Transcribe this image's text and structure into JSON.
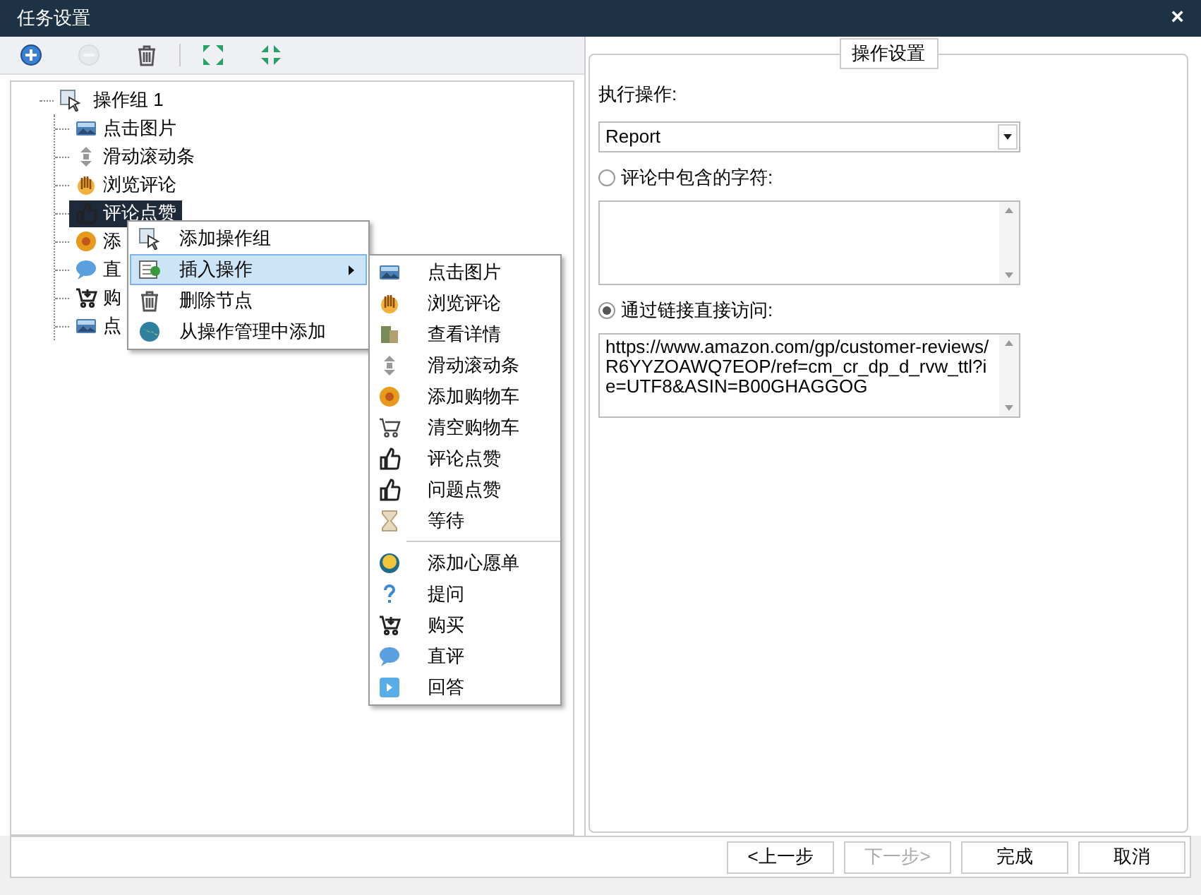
{
  "window": {
    "title": "任务设置",
    "close": "×"
  },
  "toolbar": [
    {
      "kind": "add",
      "disabled": false
    },
    {
      "kind": "remove",
      "disabled": true
    },
    {
      "kind": "trash",
      "disabled": false
    },
    {
      "kind": "expand",
      "disabled": false
    },
    {
      "kind": "collapse",
      "disabled": false
    }
  ],
  "tree": {
    "label": "操作组 1",
    "kind": "cursor",
    "children": [
      {
        "label": "点击图片",
        "kind": "image",
        "selected": false
      },
      {
        "label": "滑动滚动条",
        "kind": "scroll",
        "selected": false
      },
      {
        "label": "浏览评论",
        "kind": "hand",
        "selected": false
      },
      {
        "label": "评论点赞",
        "kind": "thumb",
        "selected": true
      },
      {
        "label": "添",
        "kind": "basket",
        "selected": false
      },
      {
        "label": "直",
        "kind": "chat",
        "selected": false
      },
      {
        "label": "购",
        "kind": "cart",
        "selected": false
      },
      {
        "label": "点",
        "kind": "image",
        "selected": false
      }
    ]
  },
  "context_menu": {
    "items": [
      {
        "label": "添加操作组",
        "kind": "cursor",
        "selected": false,
        "submenu": false
      },
      {
        "label": "插入操作",
        "kind": "insert",
        "selected": true,
        "submenu": true
      },
      {
        "label": "删除节点",
        "kind": "trash",
        "selected": false,
        "submenu": false
      },
      {
        "label": "从操作管理中添加",
        "kind": "globe",
        "selected": false,
        "submenu": false
      }
    ]
  },
  "submenu": {
    "groups": [
      [
        {
          "label": "点击图片",
          "kind": "image"
        },
        {
          "label": "浏览评论",
          "kind": "hand"
        },
        {
          "label": "查看详情",
          "kind": "book"
        },
        {
          "label": "滑动滚动条",
          "kind": "scroll"
        },
        {
          "label": "添加购物车",
          "kind": "basket"
        },
        {
          "label": "清空购物车",
          "kind": "emptycart"
        },
        {
          "label": "评论点赞",
          "kind": "thumb"
        },
        {
          "label": "问题点赞",
          "kind": "thumb"
        },
        {
          "label": "等待",
          "kind": "hourglass"
        }
      ],
      [
        {
          "label": "添加心愿单",
          "kind": "wish"
        },
        {
          "label": "提问",
          "kind": "question"
        },
        {
          "label": "购买",
          "kind": "cart"
        },
        {
          "label": "直评",
          "kind": "chat"
        },
        {
          "label": "回答",
          "kind": "reply"
        }
      ]
    ]
  },
  "settings": {
    "legend": "操作设置",
    "action_label": "执行操作:",
    "action_value": "Report",
    "options": [
      {
        "label": "评论中包含的字符:",
        "selected": false
      },
      {
        "label": "通过链接直接访问:",
        "selected": true,
        "value": "https://www.amazon.com/gp/customer-reviews/R6YYZOAWQ7EOP/ref=cm_cr_dp_d_rvw_ttl?ie=UTF8&ASIN=B00GHAGGOG"
      }
    ]
  },
  "buttons": [
    {
      "label": "<上一步",
      "disabled": false
    },
    {
      "label": "下一步>",
      "disabled": true
    },
    {
      "label": "完成",
      "disabled": false
    },
    {
      "label": "取消",
      "disabled": false
    }
  ]
}
